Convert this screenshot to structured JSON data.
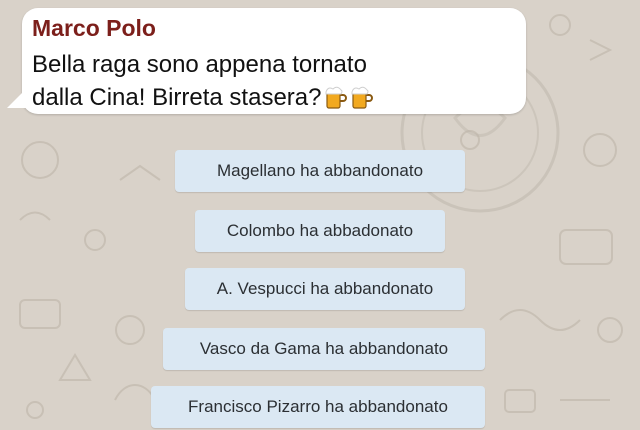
{
  "chat": {
    "incoming_message": {
      "sender": "Marco Polo",
      "text_line1": "Bella raga sono appena tornato",
      "text_line2": "dalla Cina! Birreta stasera?",
      "emoji": [
        "beer-mug-icon",
        "beer-mug-icon"
      ]
    },
    "system_messages": [
      {
        "text": "Magellano ha abbandonato"
      },
      {
        "text": "Colombo ha abbadonato"
      },
      {
        "text": "A. Vespucci ha abbandonato"
      },
      {
        "text": "Vasco da Gama ha abbandonato"
      },
      {
        "text": "Francisco Pizarro ha abbandonato"
      }
    ]
  },
  "colors": {
    "wallpaper": "#d9d2c9",
    "bubble": "#ffffff",
    "sender_name": "#7c1f1b",
    "system_bubble": "#dbe8f3"
  }
}
